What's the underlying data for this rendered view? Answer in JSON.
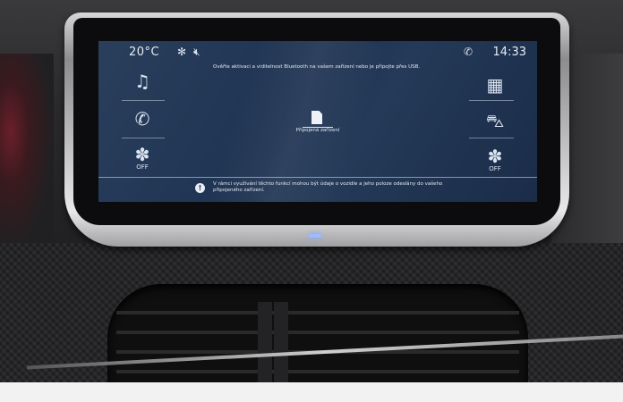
{
  "status_bar": {
    "temperature": "20°C",
    "fan_icon": "fan-icon",
    "mute_icon": "speaker-muted-icon",
    "connection_icon": "phone-connected-icon",
    "time": "14:33"
  },
  "left_menu": {
    "items": [
      {
        "icon": "music-note-icon",
        "glyph": "♫",
        "label": ""
      },
      {
        "icon": "phone-icon",
        "glyph": "✆",
        "label": ""
      },
      {
        "icon": "climate-fan-icon",
        "glyph": "✽",
        "label": "OFF"
      }
    ]
  },
  "right_menu": {
    "items": [
      {
        "icon": "apps-grid-icon",
        "glyph": "▦",
        "label": ""
      },
      {
        "icon": "car-icon",
        "glyph": "⛍",
        "label": ""
      },
      {
        "icon": "climate-fan-icon",
        "glyph": "✽",
        "label": "OFF"
      }
    ]
  },
  "main": {
    "top_notice": "Ověřte aktivaci a viditelnost Bluetooth na vašem zařízení nebo je připojte přes USB.",
    "device_button_label": "Připojená zařízení",
    "bottom_info": "V rámci využívání těchto funkcí mohou být údaje o vozidle a jeho poloze odeslány do vašeho připojeného zařízení."
  },
  "colors": {
    "screen_bg": "#1e3352",
    "text": "#e6ecf5",
    "accent_glow": "#9bbcff"
  }
}
